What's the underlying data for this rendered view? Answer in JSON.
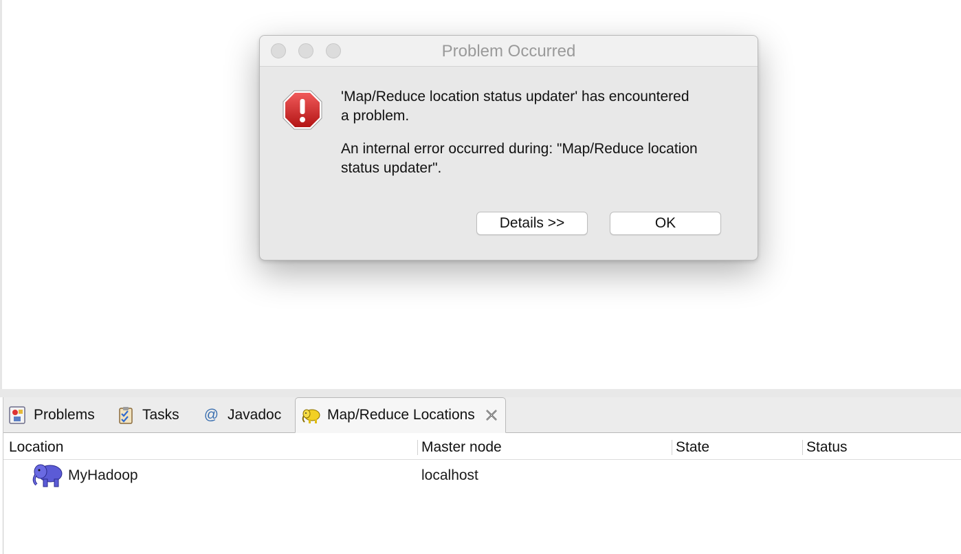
{
  "dialog": {
    "title": "Problem Occurred",
    "message1": "'Map/Reduce location status updater' has encountered a problem.",
    "message1_line1": "'Map/Reduce location status updater' has encountered",
    "message1_line2": "a problem.",
    "message2_line1": "An internal error occurred during: \"Map/Reduce location",
    "message2_line2": "status updater\".",
    "details_label": "Details >>",
    "ok_label": "OK",
    "icon": "error-octagon-icon",
    "icon_color": "#d22b2b"
  },
  "tabs": [
    {
      "label": "Problems",
      "icon": "problems-icon"
    },
    {
      "label": "Tasks",
      "icon": "tasks-icon"
    },
    {
      "label": "Javadoc",
      "icon": "javadoc-at-icon",
      "glyph": "@"
    },
    {
      "label": "Map/Reduce Locations",
      "icon": "hadoop-elephant-icon",
      "active": true
    }
  ],
  "table": {
    "columns": [
      "Location",
      "Master node",
      "State",
      "Status"
    ],
    "rows": [
      {
        "location": "MyHadoop",
        "master_node": "localhost",
        "state": "",
        "status": "",
        "icon": "hadoop-elephant-icon"
      }
    ]
  },
  "colors": {
    "elephant": "#5b5bd6",
    "tab_active_bg": "#f6f6f6",
    "dialog_bg": "#e8e8e8"
  }
}
